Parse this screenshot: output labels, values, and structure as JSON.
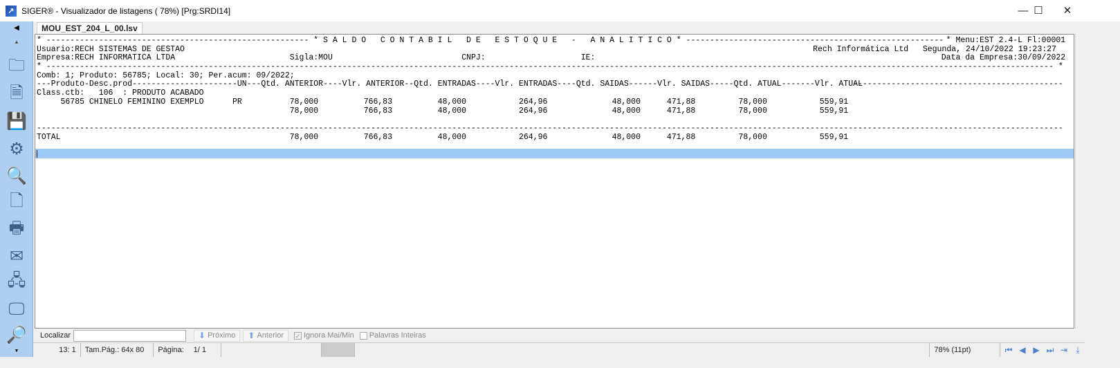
{
  "window": {
    "title": "SIGER® - Visualizador de listagens ( 78%) [Prg:SRDI14]",
    "minimize": "—",
    "maximize": "☐",
    "close": "✕"
  },
  "tab": {
    "label": "MOU_EST_204_L_00.lsv"
  },
  "sidebar": {
    "icons": [
      "folder-open",
      "document-delete",
      "save",
      "settings",
      "preview",
      "pdf",
      "printer",
      "email",
      "network",
      "monitor",
      "zoom-in"
    ]
  },
  "report": {
    "title": "* S A L D O   C O N T A B I L   D E   E S T O Q U E   -   A N A L I T I C O *",
    "menu": "* Menu:EST 2.4-L Fl:00001",
    "usuario": "Usuario:RECH SISTEMAS DE GESTAO",
    "company_datetime": "Rech Informática Ltd   Segunda, 24/10/2022 19:23:27",
    "empresa": "Empresa:RECH INFORMATICA LTDA",
    "sigla": "Sigla:MOU",
    "cnpj": "CNPJ:",
    "ie": "IE:",
    "data_empresa": "Data da Empresa:30/09/2022",
    "filter": "Comb: 1; Produto: 56785; Local: 30; Per.acum: 09/2022;",
    "header": "---Produto-Desc.prod----------------------UN---Qtd. ANTERIOR----Vlr. ANTERIOR--Qtd. ENTRADAS----Vlr. ENTRADAS----Qtd. SAIDAS------Vlr. SAIDAS-----Qtd. ATUAL-------Vlr. ATUAL",
    "class_ctb": "Class.ctb:   106  : PRODUTO ACABADO",
    "rows": [
      {
        "product": "56785 CHINELO FEMININO EXEMPLO",
        "un": "PR",
        "values": [
          "78,000",
          "766,83",
          "48,000",
          "264,96",
          "48,000",
          "471,88",
          "78,000",
          "559,91"
        ]
      },
      {
        "product": "",
        "un": "",
        "values": [
          "78,000",
          "766,83",
          "48,000",
          "264,96",
          "48,000",
          "471,88",
          "78,000",
          "559,91"
        ]
      }
    ],
    "total": {
      "label": "TOTAL",
      "values": [
        "78,000",
        "766,83",
        "48,000",
        "264,96",
        "48,000",
        "471,88",
        "78,000",
        "559,91"
      ]
    }
  },
  "findbar": {
    "label": "Localizar",
    "value": "",
    "next": "Próximo",
    "prev": "Anterior",
    "ignore_case": "Ignora Mai/Min",
    "ignore_case_checked": true,
    "whole_words": "Palavras Inteiras",
    "whole_words_checked": false
  },
  "statusbar": {
    "position": "13:  1",
    "page_size": "Tam.Pág.:  64x 80",
    "page_label": "Página:",
    "page": "1/   1",
    "zoom": "78% (11pt)"
  }
}
